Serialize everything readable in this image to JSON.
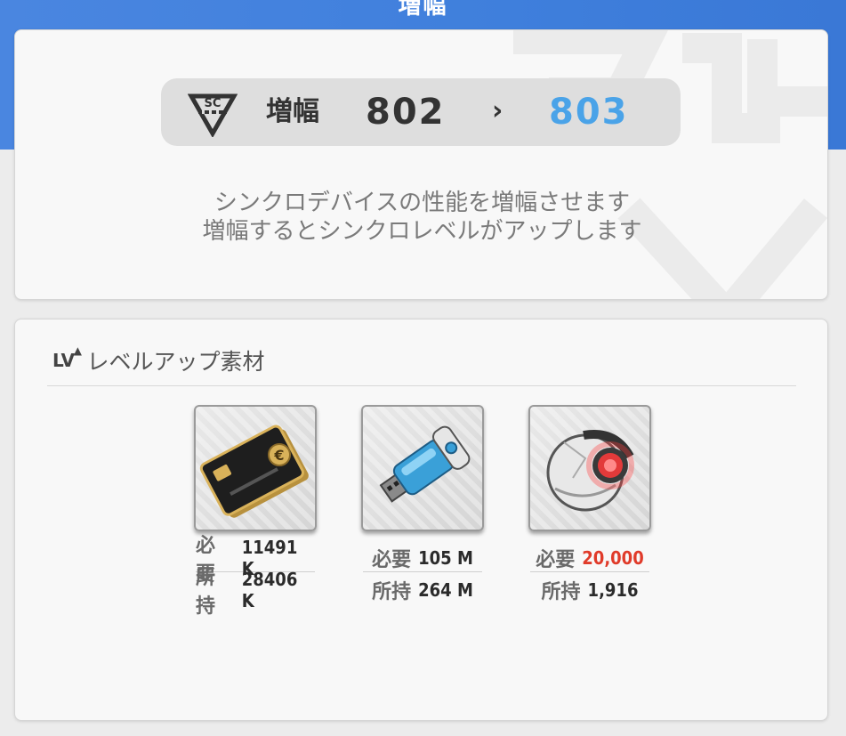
{
  "header": {
    "title": "増幅"
  },
  "upgrade": {
    "logo_icon": "sc-emblem-icon",
    "label": "増幅",
    "from_level": "802",
    "arrow": "›",
    "to_level": "803",
    "to_color": "#4aa3e8",
    "description_lines": [
      "シンクロデバイスの性能を増幅させます",
      "増幅するとシンクロレベルがアップします"
    ]
  },
  "materials": {
    "icon_text": "LV",
    "icon_name": "level-up-icon",
    "title": "レベルアップ素材",
    "required_label": "必要",
    "owned_label": "所持",
    "shortage_color": "#e03b2a",
    "items": [
      {
        "icon": "credit-card-icon",
        "required": "11491 K",
        "owned": "28406 K",
        "shortage": false
      },
      {
        "icon": "usb-drive-icon",
        "required": "105 M",
        "owned": "264 M",
        "shortage": false
      },
      {
        "icon": "core-orb-icon",
        "required": "20,000",
        "owned": "1,916",
        "shortage": true
      }
    ]
  }
}
